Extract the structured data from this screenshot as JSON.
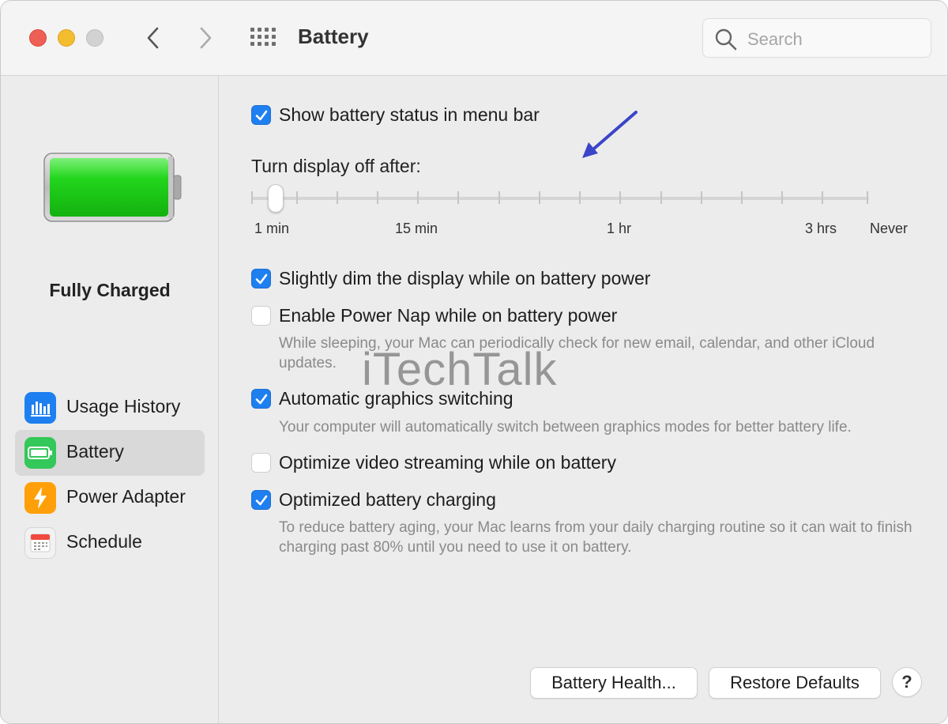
{
  "window": {
    "title": "Battery",
    "search_placeholder": "Search"
  },
  "sidebar": {
    "status": "Fully Charged",
    "items": [
      {
        "label": "Usage History",
        "icon": "bar-chart-icon",
        "color": "#1e7ff0"
      },
      {
        "label": "Battery",
        "icon": "battery-icon",
        "color": "#34c759",
        "selected": true
      },
      {
        "label": "Power Adapter",
        "icon": "bolt-icon",
        "color": "#ff9f0a"
      },
      {
        "label": "Schedule",
        "icon": "calendar-icon",
        "color": "#f2f2f2"
      }
    ]
  },
  "main": {
    "show_status": {
      "label": "Show battery status in menu bar",
      "checked": true
    },
    "display_off": {
      "label": "Turn display off after:",
      "tick_labels": [
        "1 min",
        "15 min",
        "1 hr",
        "3 hrs",
        "Never"
      ],
      "selected": "1 min"
    },
    "options": [
      {
        "label": "Slightly dim the display while on battery power",
        "checked": true,
        "description": ""
      },
      {
        "label": "Enable Power Nap while on battery power",
        "checked": false,
        "description": "While sleeping, your Mac can periodically check for new email, calendar, and other iCloud updates."
      },
      {
        "label": "Automatic graphics switching",
        "checked": true,
        "description": "Your computer will automatically switch between graphics modes for better battery life."
      },
      {
        "label": "Optimize video streaming while on battery",
        "checked": false,
        "description": ""
      },
      {
        "label": "Optimized battery charging",
        "checked": true,
        "description": "To reduce battery aging, your Mac learns from your daily charging routine so it can wait to finish charging past 80% until you need to use it on battery."
      }
    ],
    "watermark": "iTechTalk",
    "buttons": {
      "battery_health": "Battery Health...",
      "restore_defaults": "Restore Defaults",
      "help": "?"
    }
  },
  "colors": {
    "accent": "#1e7ff0",
    "battery_green": "#2fd62a",
    "annotation_arrow": "#3b45c8"
  }
}
